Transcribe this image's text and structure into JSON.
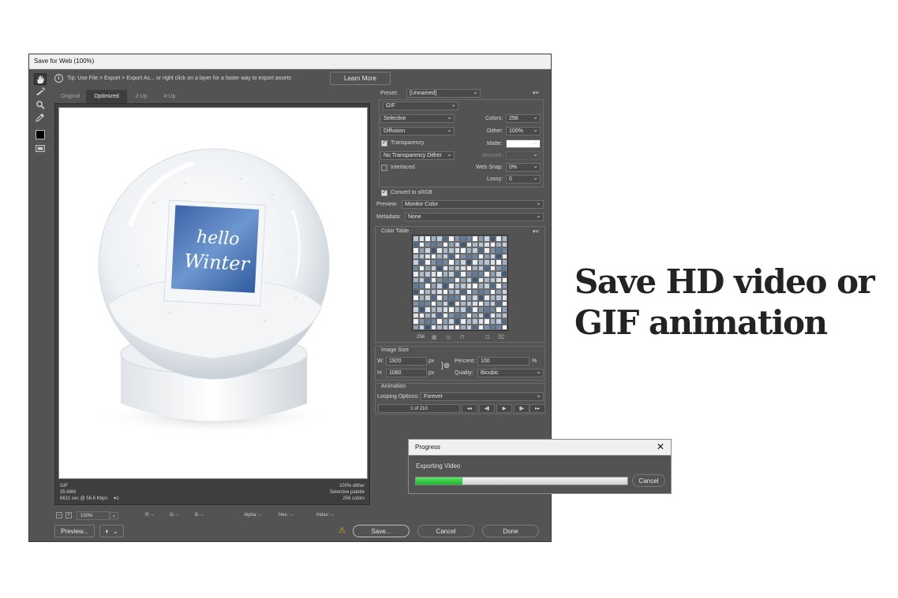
{
  "window": {
    "title": "Save for Web (100%)"
  },
  "tip": {
    "text": "Tip: Use File > Export > Export As...  or right click on a layer for a faster way to export assets",
    "learn_more": "Learn More"
  },
  "tools": [
    "hand-icon",
    "slice-select-icon",
    "zoom-icon",
    "eyedropper-icon",
    "color-swatch-icon",
    "toggle-slices-icon"
  ],
  "tabs": [
    {
      "label": "Original",
      "selected": false
    },
    {
      "label": "Optimized",
      "selected": true
    },
    {
      "label": "2-Up",
      "selected": false
    },
    {
      "label": "4-Up",
      "selected": false
    }
  ],
  "artwork": {
    "line1": "hello",
    "line2": "Winter"
  },
  "preview_info": {
    "left": [
      "GIF",
      "35.68M",
      "6611 sec @ 56.6 Kbps"
    ],
    "right": [
      "100% dither",
      "Selective palette",
      "256 colors"
    ]
  },
  "statusbar": {
    "zoom": "100%",
    "r": "R: --",
    "g": "G: --",
    "b": "B: --",
    "alpha": "Alpha: --",
    "hex": "Hex: --",
    "index": "Index: --"
  },
  "settings": {
    "preset_label": "Preset:",
    "preset_value": "[Unnamed]",
    "format": "GIF",
    "reduction": "Selective",
    "dither_algo": "Diffusion",
    "transparency_label": "Transparency",
    "transparency": true,
    "matte_dither": "No Transparency Dither",
    "interlaced_label": "Interlaced",
    "interlaced": false,
    "colors_label": "Colors:",
    "colors_value": "256",
    "dither_label": "Dither:",
    "dither_value": "100%",
    "matte_label": "Matte:",
    "amount_label": "Amount:",
    "websnap_label": "Web Snap:",
    "websnap_value": "0%",
    "lossy_label": "Lossy:",
    "lossy_value": "0",
    "convert_label": "Convert to sRGB",
    "convert": true,
    "preview_label": "Preview:",
    "preview_value": "Monitor Color",
    "metadata_label": "Metadata:",
    "metadata_value": "None"
  },
  "color_table": {
    "title": "Color Table",
    "count": "256",
    "colors": [
      "#b8c7d6",
      "#7e93a8",
      "#e5ebf0",
      "#4d6a8a",
      "#c9d6e2",
      "#9fb2c5",
      "#ffffff",
      "#d9e2ea",
      "#5f7c9c",
      "#aab9c8",
      "#eef2f5",
      "#3d5777",
      "#c2cfdc",
      "#8aa0b6",
      "#f5f7f9",
      "#6b88a6"
    ]
  },
  "image_size": {
    "title": "Image Size",
    "w_label": "W:",
    "w_value": "1920",
    "w_unit": "px",
    "h_label": "H:",
    "h_value": "1080",
    "h_unit": "px",
    "percent_label": "Percent:",
    "percent_value": "100",
    "percent_unit": "%",
    "quality_label": "Quality:",
    "quality_value": "Bicubic"
  },
  "animation": {
    "title": "Animation",
    "looping_label": "Looping Options:",
    "looping_value": "Forever",
    "frame": "1 of 210"
  },
  "buttons": {
    "preview": "Preview...",
    "save": "Save...",
    "cancel": "Cancel",
    "done": "Done"
  },
  "progress": {
    "title": "Progress",
    "text": "Exporting Video",
    "cancel": "Cancel",
    "value": 0.22
  },
  "headline": {
    "line1": "Save HD video or",
    "line2": "GIF animation"
  }
}
